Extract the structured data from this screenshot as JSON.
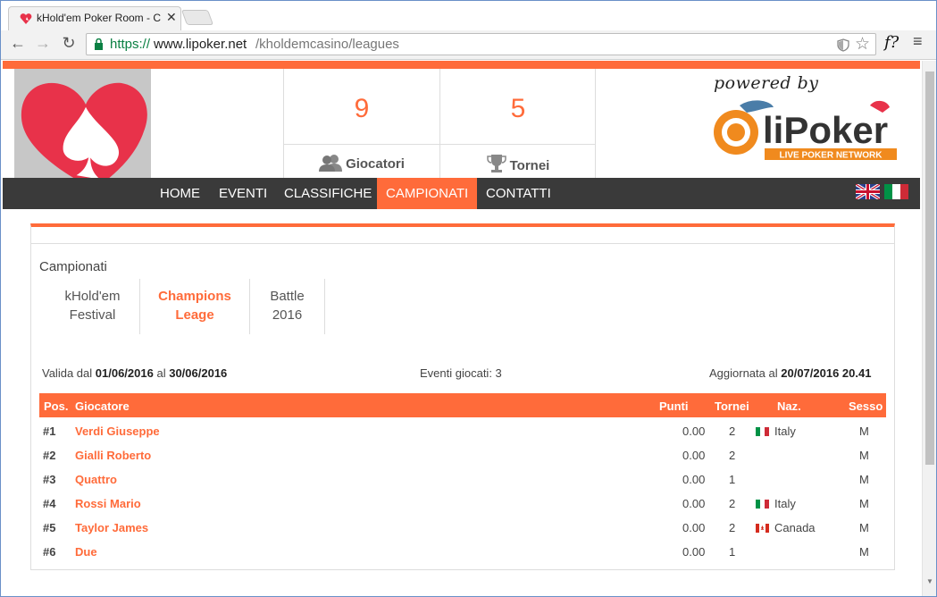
{
  "browser": {
    "tab_title": "kHold'em Poker Room - C",
    "url_scheme": "https://",
    "url_host": "www.lipoker.net",
    "url_path": "/kholdemcasino/leagues",
    "ext_label": "f?"
  },
  "stats": [
    {
      "value": "9",
      "label": "Giocatori",
      "icon": "users-icon"
    },
    {
      "value": "5",
      "label": "Tornei",
      "icon": "trophy-icon"
    }
  ],
  "brand": {
    "powered_by": "powered by",
    "logo_text": "liPoker",
    "logo_tag": "LIVE POKER NETWORK"
  },
  "nav": {
    "items": [
      {
        "label": "HOME",
        "active": false
      },
      {
        "label": "EVENTI",
        "active": false
      },
      {
        "label": "CLASSIFICHE",
        "active": false
      },
      {
        "label": "CAMPIONATI",
        "active": true
      },
      {
        "label": "CONTATTI",
        "active": false
      }
    ]
  },
  "championships": {
    "title": "Campionati",
    "tabs": [
      {
        "line1": "kHold'em",
        "line2": "Festival",
        "active": false
      },
      {
        "line1": "Champions",
        "line2": "Leage",
        "active": true
      },
      {
        "line1": "Battle",
        "line2": "2016",
        "active": false
      }
    ],
    "valid_prefix": "Valida dal",
    "valid_from": "01/06/2016",
    "valid_mid": "al",
    "valid_to": "30/06/2016",
    "events_played": "Eventi giocati: 3",
    "updated_prefix": "Aggiornata al",
    "updated_at": "20/07/2016 20.41"
  },
  "table": {
    "headers": {
      "pos": "Pos.",
      "player": "Giocatore",
      "points": "Punti",
      "tournaments": "Tornei",
      "nation": "Naz.",
      "sex": "Sesso"
    },
    "rows": [
      {
        "pos": "#1",
        "player": "Verdi Giuseppe",
        "points": "0.00",
        "tournaments": "2",
        "nation": "Italy",
        "flag": "italy",
        "sex": "M"
      },
      {
        "pos": "#2",
        "player": "Gialli Roberto",
        "points": "0.00",
        "tournaments": "2",
        "nation": "",
        "flag": "",
        "sex": "M"
      },
      {
        "pos": "#3",
        "player": "Quattro",
        "points": "0.00",
        "tournaments": "1",
        "nation": "",
        "flag": "",
        "sex": "M"
      },
      {
        "pos": "#4",
        "player": "Rossi Mario",
        "points": "0.00",
        "tournaments": "2",
        "nation": "Italy",
        "flag": "italy",
        "sex": "M"
      },
      {
        "pos": "#5",
        "player": "Taylor James",
        "points": "0.00",
        "tournaments": "2",
        "nation": "Canada",
        "flag": "canada",
        "sex": "M"
      },
      {
        "pos": "#6",
        "player": "Due",
        "points": "0.00",
        "tournaments": "1",
        "nation": "",
        "flag": "",
        "sex": "M"
      }
    ]
  },
  "colors": {
    "accent": "#ff6b3a",
    "navbar": "#3a3a3a",
    "logo_heart": "#e8324a"
  }
}
